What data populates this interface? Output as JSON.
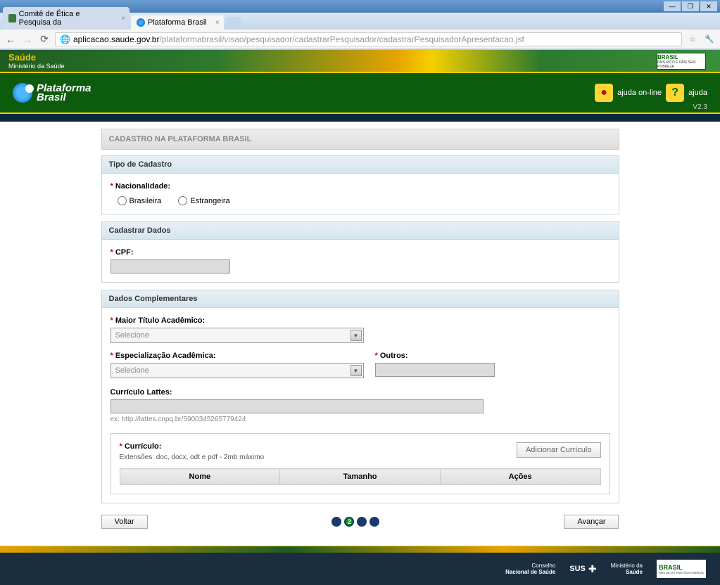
{
  "browser": {
    "tab1": "Comitê de Ética e Pesquisa da ",
    "tab2": "Plataforma Brasil",
    "url_host": "aplicacao.saude.gov.br",
    "url_path": "/plataformabrasil/visao/pesquisador/cadastrarPesquisador/cadastrarPesquisadorApresentacao.jsf"
  },
  "header": {
    "saude": "Saúde",
    "saude_sub": "Ministério da Saúde",
    "brasil": "BRASIL",
    "brasil_sub": "PAÍS RICO É PAÍS SEM POBREZA",
    "logo1": "Plataforma",
    "logo2": "Brasil",
    "ajuda_online": "ajuda on-line",
    "ajuda": "ajuda",
    "version": "V2.3"
  },
  "page": {
    "title": "CADASTRO NA PLATAFORMA BRASIL",
    "tipo_cadastro": "Tipo de Cadastro",
    "nacionalidade": "Nacionalidade:",
    "brasileira": "Brasileira",
    "estrangeira": "Estrangeira",
    "cadastrar_dados": "Cadastrar Dados",
    "cpf": "CPF:",
    "dados_comp": "Dados Complementares",
    "maior_titulo": "Maior Título Acadêmico:",
    "selecione": "Selecione",
    "espec": "Especialização Acadêmica:",
    "outros": "Outros:",
    "lattes": "Currículo Lattes:",
    "lattes_hint": "ex: http://lattes.cnpq.br/5900345265779424",
    "curriculo": "Currículo:",
    "curriculo_ext": "Extensões: doc, docx, odt e pdf - 2mb máximo",
    "add_curriculo": "Adicionar Currículo",
    "th_nome": "Nome",
    "th_tamanho": "Tamanho",
    "th_acoes": "Ações",
    "voltar": "Voltar",
    "avancar": "Avançar",
    "step_active": "2"
  },
  "footer": {
    "conselho": "Conselho",
    "conselho2": "Nacional de Saúde",
    "sus": "SUS",
    "ministerio": "Ministério da",
    "ministerio2": "Saúde",
    "brasil": "BRASIL",
    "brasil_sub": "PAÍS RICO É PAÍS SEM POBREZA"
  }
}
